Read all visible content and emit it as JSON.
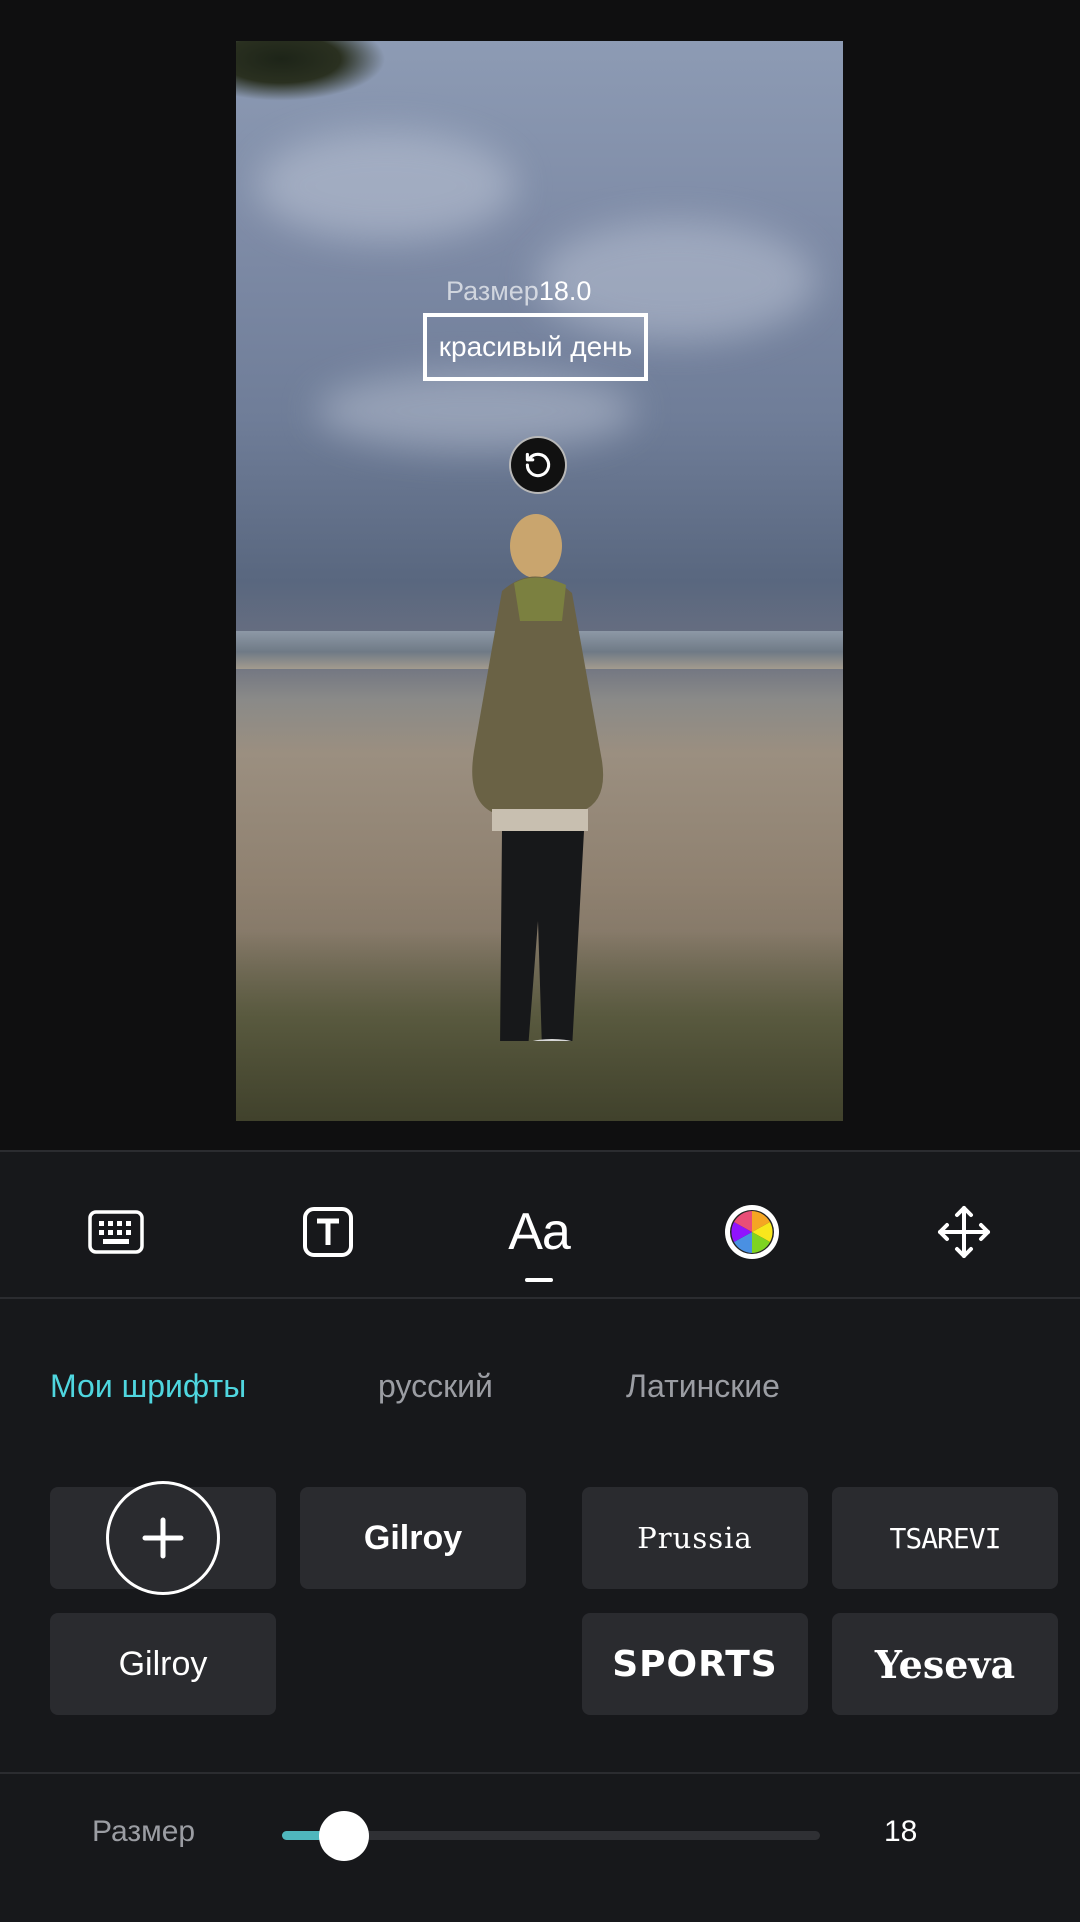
{
  "canvas": {
    "size_label": "Размер",
    "size_value": "18.0",
    "text": "красивый день"
  },
  "toolbar": {
    "tools": [
      "keyboard-icon",
      "text-style-icon",
      "font-icon",
      "color-wheel-icon",
      "move-icon"
    ],
    "font_tool_label": "Aa",
    "active_tool": "font"
  },
  "tabs": [
    {
      "label": "Мои шрифты",
      "active": true
    },
    {
      "label": "русский",
      "active": false
    },
    {
      "label": "Латинские",
      "active": false
    }
  ],
  "fonts": {
    "add_label": "+",
    "items": [
      "Gilroy",
      "Gilroy",
      "Prussia",
      "TSAREVI",
      "SPORTS",
      "Yeseva"
    ]
  },
  "size_control": {
    "label": "Размер",
    "value": "18",
    "fraction": 0.115
  },
  "colors": {
    "accent": "#4fd6df",
    "slider_fill": "#4fb7bd",
    "panel_bg": "#17181b",
    "tile_bg": "#2a2b2f"
  }
}
